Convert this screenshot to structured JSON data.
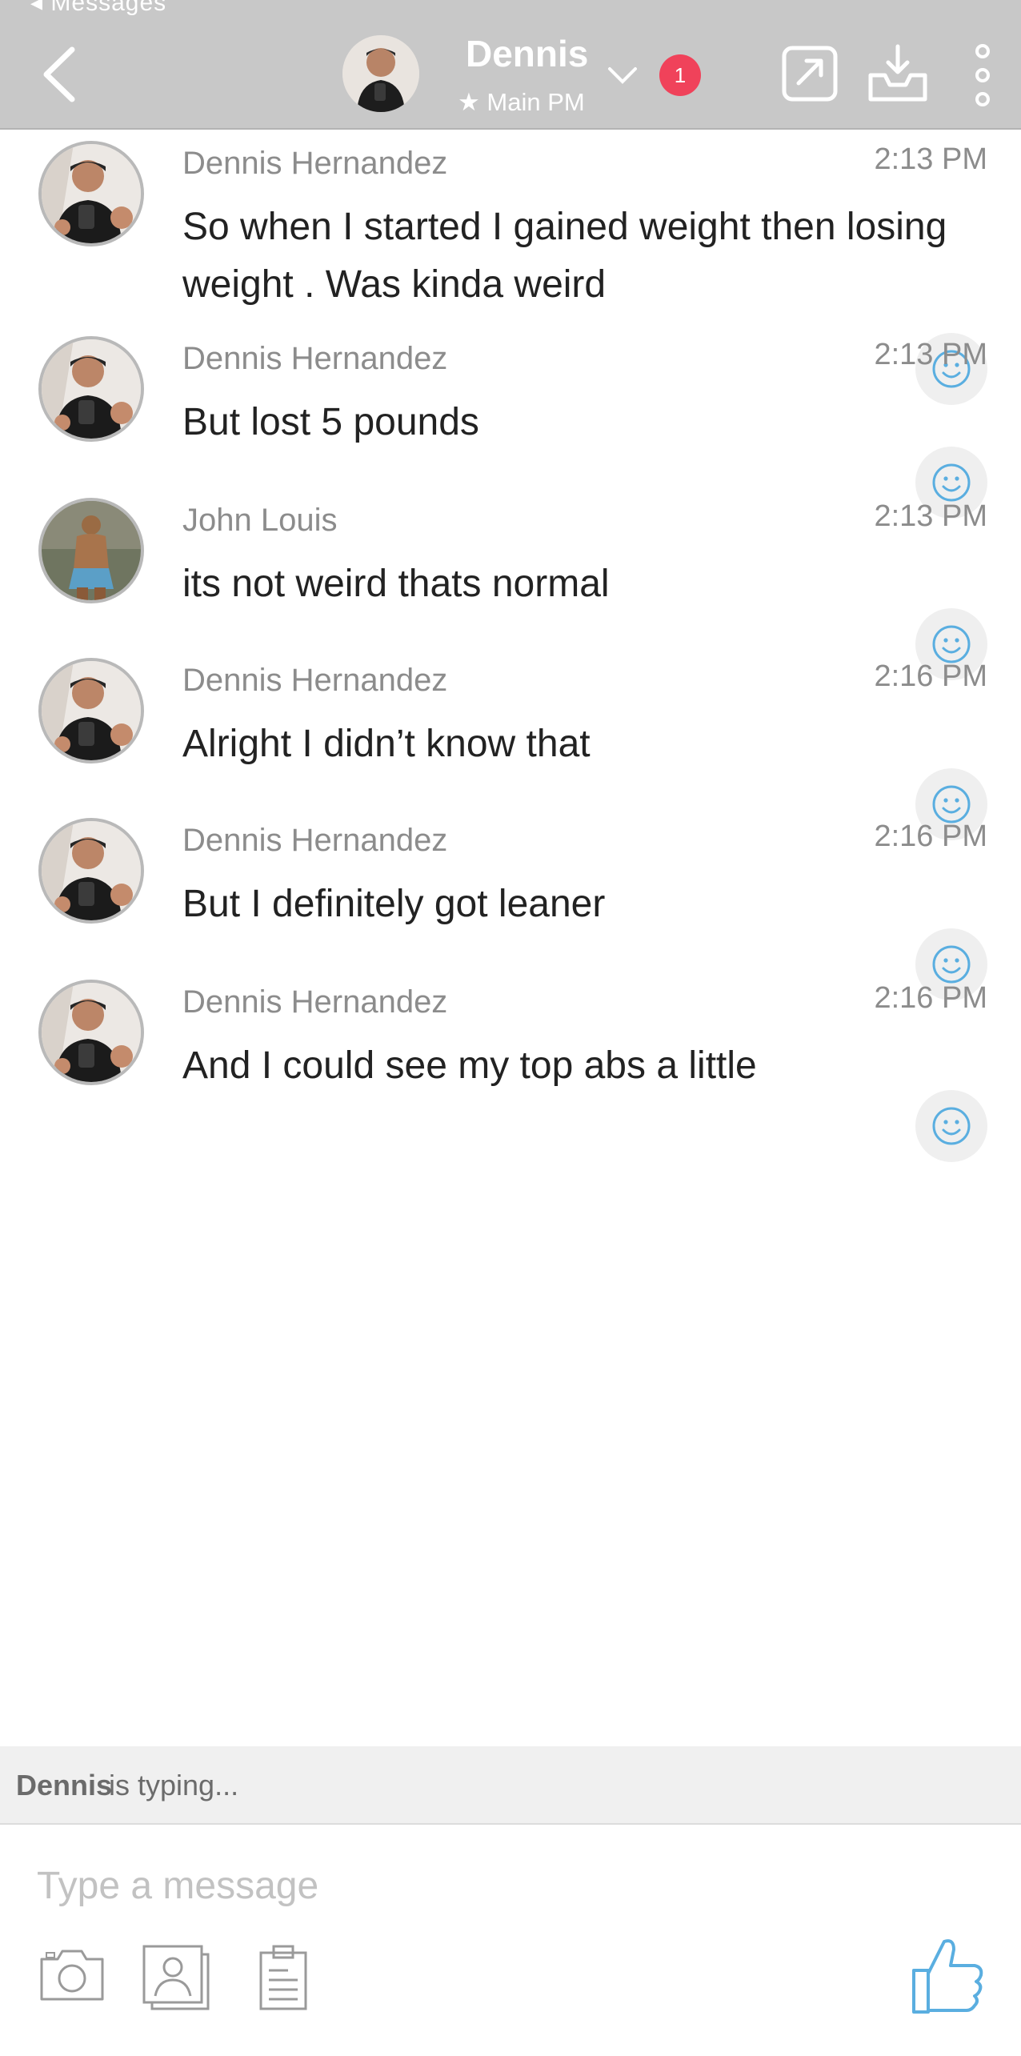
{
  "status_bar": {
    "back_label": "◂ Messages"
  },
  "header": {
    "name": "Dennis",
    "subtitle": "★ Main PM",
    "badge_count": "1",
    "icons": [
      "back-chevron-icon",
      "chevron-down-icon",
      "share-external-icon",
      "inbox-download-icon",
      "more-vertical-icon"
    ]
  },
  "messages": [
    {
      "sender": "Dennis Hernandez",
      "time": "2:13 PM",
      "text": "So when I started I gained weight then losing weight . Was kinda weird",
      "avatar": "dennis"
    },
    {
      "sender": "Dennis Hernandez",
      "time": "2:13 PM",
      "text": "But lost 5 pounds",
      "avatar": "dennis"
    },
    {
      "sender": "John Louis",
      "time": "2:13 PM",
      "text": "its not weird thats normal",
      "avatar": "john"
    },
    {
      "sender": "Dennis Hernandez",
      "time": "2:16 PM",
      "text": "Alright I didn’t know that",
      "avatar": "dennis"
    },
    {
      "sender": "Dennis Hernandez",
      "time": "2:16 PM",
      "text": "But I definitely got leaner",
      "avatar": "dennis"
    },
    {
      "sender": "Dennis Hernandez",
      "time": "2:16 PM",
      "text": "And I could see my top abs a little",
      "avatar": "dennis"
    }
  ],
  "typing": {
    "name": "Dennis",
    "rest": "is typing..."
  },
  "composer": {
    "placeholder": "Type a message",
    "tools": [
      "camera-icon",
      "contact-card-icon",
      "clipboard-document-icon"
    ],
    "send_icon": "thumbs-up-icon"
  },
  "colors": {
    "header_bg": "#c8c8c8",
    "badge": "#f0425a",
    "accent_blue": "#5aaee0",
    "meta_gray": "#8c8c8c"
  }
}
